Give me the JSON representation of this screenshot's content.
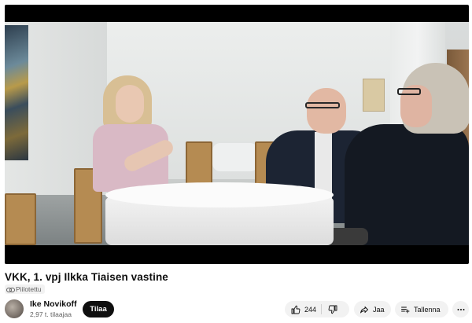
{
  "video": {
    "title": "VKK, 1. vpj Ilkka Tiaisen vastine",
    "visibility": "Piilotettu"
  },
  "channel": {
    "name": "Ike Novikoff",
    "subscribers": "2,97 t. tilaajaa",
    "subscribe_label": "Tilaa"
  },
  "actions": {
    "like_count": "244",
    "share_label": "Jaa",
    "save_label": "Tallenna"
  },
  "icons": {
    "unlisted": "link-icon",
    "like": "thumbs-up-icon",
    "dislike": "thumbs-down-icon",
    "share": "share-arrow-icon",
    "save": "playlist-add-icon",
    "more": "more-horizontal-icon"
  }
}
